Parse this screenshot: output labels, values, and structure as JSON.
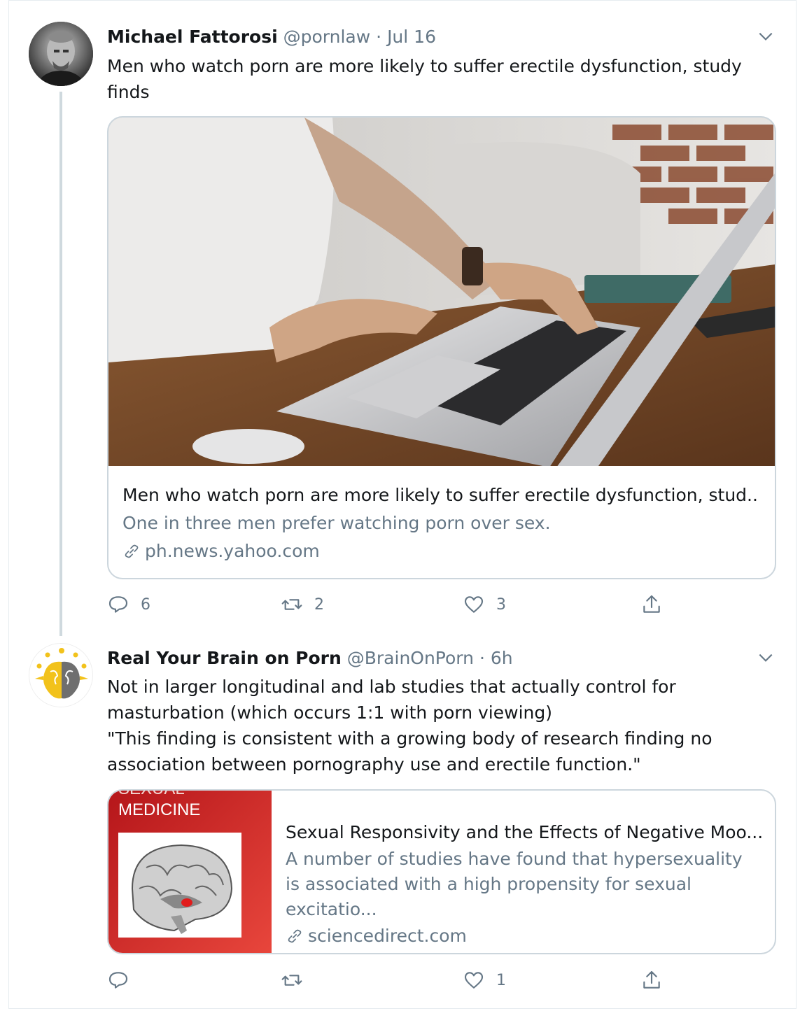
{
  "tweets": [
    {
      "author_name": "Michael Fattorosi",
      "handle": "@pornlaw",
      "date": "Jul 16",
      "text": "Men who watch porn are more likely to suffer erectile dysfunction, study finds",
      "card": {
        "title": "Men who watch porn are more likely to suffer erectile dysfunction, stud...",
        "description": "One in three men prefer watching porn over sex.",
        "domain": "ph.news.yahoo.com"
      },
      "actions": {
        "replies": "6",
        "retweets": "2",
        "likes": "3"
      }
    },
    {
      "author_name": "Real Your Brain on Porn",
      "handle": "@BrainOnPorn",
      "date": "6h",
      "text_lines": [
        "Not in larger longitudinal and lab studies that actually control for masturbation (which occurs 1:1 with porn viewing)",
        "\"This finding is consistent with a growing body of research finding no association between pornography use and erectile function.\""
      ],
      "card": {
        "thumb_title_top": "SEXUAL",
        "thumb_title": "MEDICINE",
        "title": "Sexual Responsivity and the Effects of Negative Moo...",
        "description": "A number of studies have found that hypersexuality is associated with a high propensity for sexual excitatio...",
        "domain": "sciencedirect.com"
      },
      "actions": {
        "replies": "",
        "retweets": "",
        "likes": "1"
      }
    }
  ],
  "separator": "·",
  "colors": {
    "text": "#14171a",
    "secondary": "#657786",
    "border": "#ccd6dd",
    "card_red": "#c8161b"
  },
  "icons": [
    "chevron-down-icon",
    "reply-icon",
    "retweet-icon",
    "like-icon",
    "share-icon",
    "link-icon"
  ]
}
